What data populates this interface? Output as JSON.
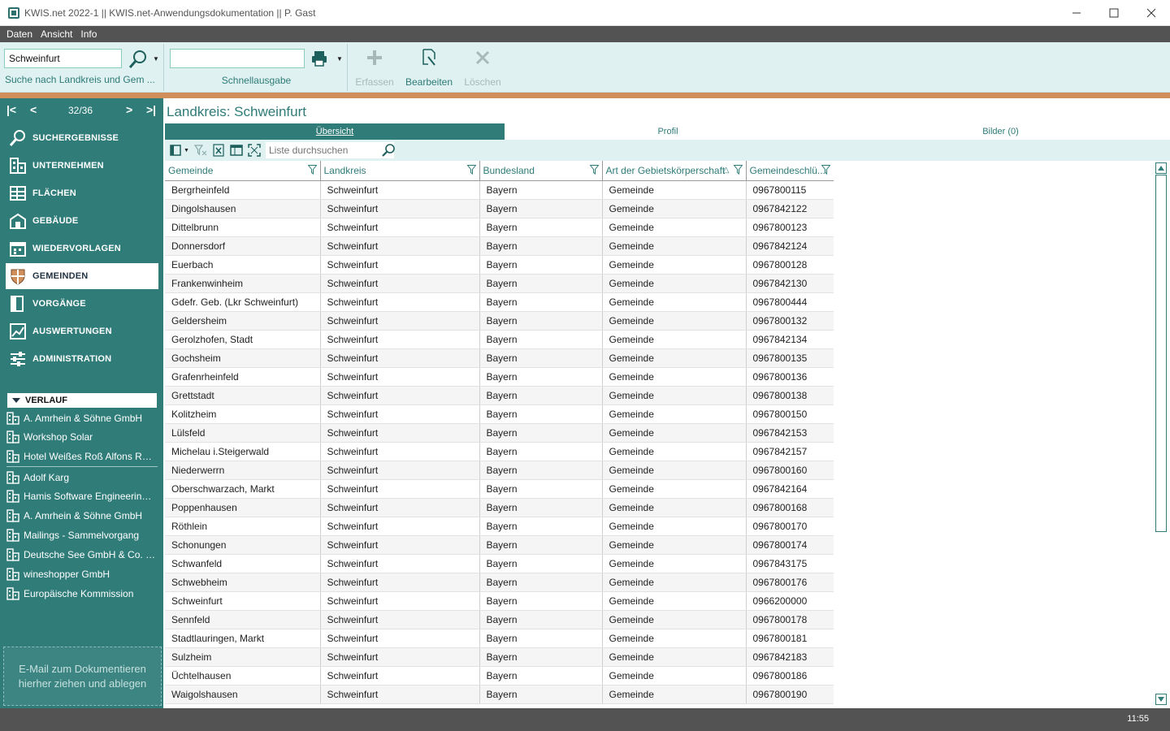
{
  "window": {
    "title": "KWIS.net 2022-1 || KWIS.net-Anwendungsdokumentation || P. Gast"
  },
  "menu": [
    "Daten",
    "Ansicht",
    "Info"
  ],
  "toolbar": {
    "search_value": "Schweinfurt",
    "search_label": "Suche  nach  Landkreis  und Gem ...",
    "quick_value": "",
    "quick_label": "Schnellausgabe",
    "erfassen": "Erfassen",
    "bearbeiten": "Bearbeiten",
    "loeschen": "Löschen"
  },
  "pager": {
    "count": "32/36"
  },
  "nav": [
    {
      "label": "SUCHERGEBNISSE",
      "icon": "search-icon",
      "active": false
    },
    {
      "label": "UNTERNEHMEN",
      "icon": "building-icon",
      "active": false
    },
    {
      "label": "FLÄCHEN",
      "icon": "area-icon",
      "active": false
    },
    {
      "label": "GEBÄUDE",
      "icon": "house-icon",
      "active": false
    },
    {
      "label": "WIEDERVORLAGEN",
      "icon": "calendar-icon",
      "active": false
    },
    {
      "label": "GEMEINDEN",
      "icon": "shield-icon",
      "active": true
    },
    {
      "label": "VORGÄNGE",
      "icon": "folder-icon",
      "active": false
    },
    {
      "label": "AUSWERTUNGEN",
      "icon": "chart-icon",
      "active": false
    },
    {
      "label": "ADMINISTRATION",
      "icon": "settings-icon",
      "active": false
    }
  ],
  "history": {
    "title": "VERLAUF",
    "items": [
      "A. Amrhein & Söhne GmbH",
      "Workshop Solar",
      "Hotel Weißes Roß Alfons Rudl...",
      "Adolf Karg",
      "Hamis Software Engineering G...",
      "A. Amrhein & Söhne GmbH",
      "Mailings - Sammelvorgang",
      "Deutsche See GmbH & Co. KG...",
      "wineshopper GmbH",
      "Europäische Kommission"
    ]
  },
  "dropzone": {
    "line1": "E-Mail  zum Dokumentieren",
    "line2": "hierher ziehen und ablegen"
  },
  "main": {
    "title": "Landkreis: Schweinfurt",
    "tabs": [
      "Übersicht",
      "Profil",
      "Bilder (0)"
    ],
    "grid_search_placeholder": "Liste durchsuchen"
  },
  "table": {
    "columns": [
      "Gemeinde",
      "Landkreis",
      "Bundesland",
      "Art der Gebietskörperschaft",
      "Gemeindeschlü..."
    ],
    "rows": [
      [
        "Bergrheinfeld",
        "Schweinfurt",
        "Bayern",
        "Gemeinde",
        "0967800115"
      ],
      [
        "Dingolshausen",
        "Schweinfurt",
        "Bayern",
        "Gemeinde",
        "0967842122"
      ],
      [
        "Dittelbrunn",
        "Schweinfurt",
        "Bayern",
        "Gemeinde",
        "0967800123"
      ],
      [
        "Donnersdorf",
        "Schweinfurt",
        "Bayern",
        "Gemeinde",
        "0967842124"
      ],
      [
        "Euerbach",
        "Schweinfurt",
        "Bayern",
        "Gemeinde",
        "0967800128"
      ],
      [
        "Frankenwinheim",
        "Schweinfurt",
        "Bayern",
        "Gemeinde",
        "0967842130"
      ],
      [
        "Gdefr. Geb. (Lkr Schweinfurt)",
        "Schweinfurt",
        "Bayern",
        "Gemeinde",
        "0967800444"
      ],
      [
        "Geldersheim",
        "Schweinfurt",
        "Bayern",
        "Gemeinde",
        "0967800132"
      ],
      [
        "Gerolzhofen, Stadt",
        "Schweinfurt",
        "Bayern",
        "Gemeinde",
        "0967842134"
      ],
      [
        "Gochsheim",
        "Schweinfurt",
        "Bayern",
        "Gemeinde",
        "0967800135"
      ],
      [
        "Grafenrheinfeld",
        "Schweinfurt",
        "Bayern",
        "Gemeinde",
        "0967800136"
      ],
      [
        "Grettstadt",
        "Schweinfurt",
        "Bayern",
        "Gemeinde",
        "0967800138"
      ],
      [
        "Kolitzheim",
        "Schweinfurt",
        "Bayern",
        "Gemeinde",
        "0967800150"
      ],
      [
        "Lülsfeld",
        "Schweinfurt",
        "Bayern",
        "Gemeinde",
        "0967842153"
      ],
      [
        "Michelau i.Steigerwald",
        "Schweinfurt",
        "Bayern",
        "Gemeinde",
        "0967842157"
      ],
      [
        "Niederwerrn",
        "Schweinfurt",
        "Bayern",
        "Gemeinde",
        "0967800160"
      ],
      [
        "Oberschwarzach, Markt",
        "Schweinfurt",
        "Bayern",
        "Gemeinde",
        "0967842164"
      ],
      [
        "Poppenhausen",
        "Schweinfurt",
        "Bayern",
        "Gemeinde",
        "0967800168"
      ],
      [
        "Röthlein",
        "Schweinfurt",
        "Bayern",
        "Gemeinde",
        "0967800170"
      ],
      [
        "Schonungen",
        "Schweinfurt",
        "Bayern",
        "Gemeinde",
        "0967800174"
      ],
      [
        "Schwanfeld",
        "Schweinfurt",
        "Bayern",
        "Gemeinde",
        "0967843175"
      ],
      [
        "Schwebheim",
        "Schweinfurt",
        "Bayern",
        "Gemeinde",
        "0967800176"
      ],
      [
        "Schweinfurt",
        "Schweinfurt",
        "Bayern",
        "Gemeinde",
        "0966200000"
      ],
      [
        "Sennfeld",
        "Schweinfurt",
        "Bayern",
        "Gemeinde",
        "0967800178"
      ],
      [
        "Stadtlauringen, Markt",
        "Schweinfurt",
        "Bayern",
        "Gemeinde",
        "0967800181"
      ],
      [
        "Sulzheim",
        "Schweinfurt",
        "Bayern",
        "Gemeinde",
        "0967842183"
      ],
      [
        "Üchtelhausen",
        "Schweinfurt",
        "Bayern",
        "Gemeinde",
        "0967800186"
      ],
      [
        "Waigolshausen",
        "Schweinfurt",
        "Bayern",
        "Gemeinde",
        "0967800190"
      ]
    ]
  },
  "status": {
    "time": "11:55"
  },
  "colors": {
    "accent": "#2f7c79",
    "toolbar_bg": "#dff1f1",
    "orange_line": "#d08e5b",
    "bar_dark": "#535353"
  }
}
